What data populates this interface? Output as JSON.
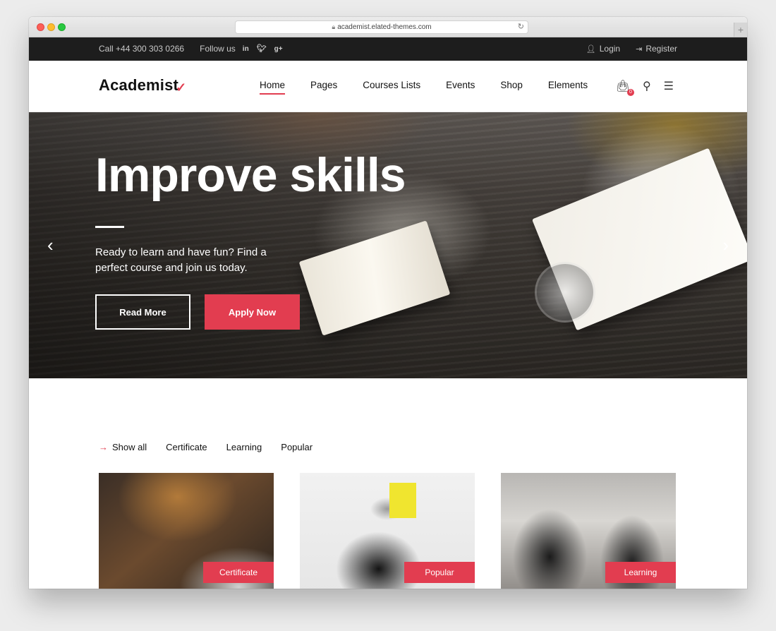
{
  "browser": {
    "url": "academist.elated-themes.com"
  },
  "topbar": {
    "phone": "Call +44 300 303 0266",
    "follow": "Follow us",
    "social": [
      "in",
      "t",
      "g+"
    ],
    "login": "Login",
    "register": "Register"
  },
  "header": {
    "logo": "Academist",
    "nav": [
      "Home",
      "Pages",
      "Courses Lists",
      "Events",
      "Shop",
      "Elements"
    ],
    "active_nav": "Home",
    "cart_count": "0"
  },
  "hero": {
    "title": "Improve skills",
    "subtitle": "Ready to learn and have fun? Find a perfect course and join us today.",
    "read_more": "Read More",
    "apply_now": "Apply Now"
  },
  "filters": [
    "Show all",
    "Certificate",
    "Learning",
    "Popular"
  ],
  "cards": [
    {
      "tag": "Certificate"
    },
    {
      "tag": "Popular"
    },
    {
      "tag": "Learning"
    }
  ],
  "colors": {
    "accent": "#e23d50",
    "topbar_bg": "#1d1d1d"
  }
}
